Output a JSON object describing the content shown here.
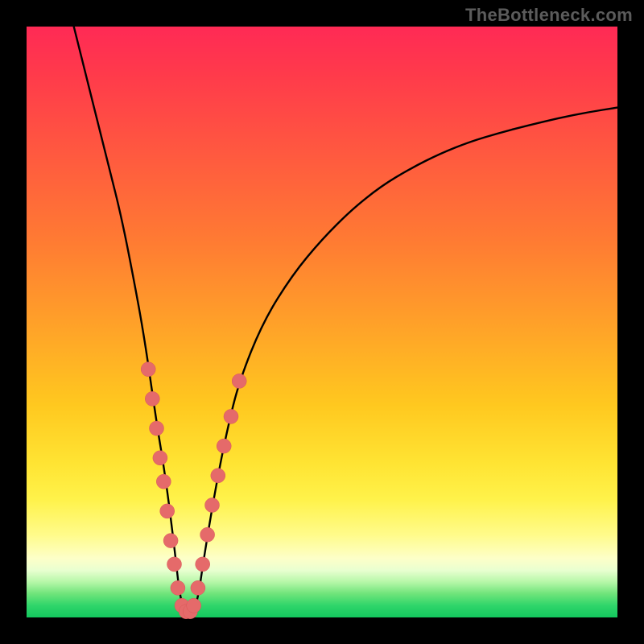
{
  "watermark": {
    "text": "TheBottleneck.com"
  },
  "chart_data": {
    "type": "line",
    "title": "",
    "xlabel": "",
    "ylabel": "",
    "xlim": [
      0,
      100
    ],
    "ylim": [
      0,
      100
    ],
    "grid": false,
    "legend": false,
    "series": [
      {
        "name": "curve",
        "x": [
          8,
          10,
          12,
          14,
          16,
          18,
          20,
          22,
          23,
          24,
          25,
          26,
          27,
          28,
          29,
          30,
          32,
          34,
          36,
          40,
          45,
          50,
          55,
          60,
          65,
          70,
          75,
          80,
          85,
          90,
          95,
          100
        ],
        "y": [
          100,
          92,
          84,
          76,
          68,
          58,
          47,
          33,
          27,
          20,
          12,
          3,
          1,
          1,
          3,
          10,
          22,
          32,
          40,
          50,
          58,
          64,
          69,
          73,
          76,
          78.5,
          80.5,
          82,
          83.3,
          84.5,
          85.5,
          86.3
        ]
      }
    ],
    "markers": [
      {
        "name": "left-branch-dot",
        "x": 20.6,
        "y": 42
      },
      {
        "name": "left-branch-dot",
        "x": 21.3,
        "y": 37
      },
      {
        "name": "left-branch-dot",
        "x": 22.0,
        "y": 32
      },
      {
        "name": "left-branch-dot",
        "x": 22.6,
        "y": 27
      },
      {
        "name": "left-branch-dot",
        "x": 23.2,
        "y": 23
      },
      {
        "name": "left-branch-dot",
        "x": 23.8,
        "y": 18
      },
      {
        "name": "left-branch-dot",
        "x": 24.4,
        "y": 13
      },
      {
        "name": "left-branch-dot",
        "x": 25.0,
        "y": 9
      },
      {
        "name": "left-branch-dot",
        "x": 25.6,
        "y": 5
      },
      {
        "name": "bottom-dot",
        "x": 26.3,
        "y": 2
      },
      {
        "name": "bottom-dot",
        "x": 27.0,
        "y": 1
      },
      {
        "name": "bottom-dot",
        "x": 27.7,
        "y": 1
      },
      {
        "name": "bottom-dot",
        "x": 28.3,
        "y": 2
      },
      {
        "name": "right-branch-dot",
        "x": 29.0,
        "y": 5
      },
      {
        "name": "right-branch-dot",
        "x": 29.8,
        "y": 9
      },
      {
        "name": "right-branch-dot",
        "x": 30.6,
        "y": 14
      },
      {
        "name": "right-branch-dot",
        "x": 31.4,
        "y": 19
      },
      {
        "name": "right-branch-dot",
        "x": 32.4,
        "y": 24
      },
      {
        "name": "right-branch-dot",
        "x": 33.4,
        "y": 29
      },
      {
        "name": "right-branch-dot",
        "x": 34.6,
        "y": 34
      },
      {
        "name": "right-branch-dot",
        "x": 36.0,
        "y": 40
      }
    ],
    "marker_radius_px": 9
  }
}
